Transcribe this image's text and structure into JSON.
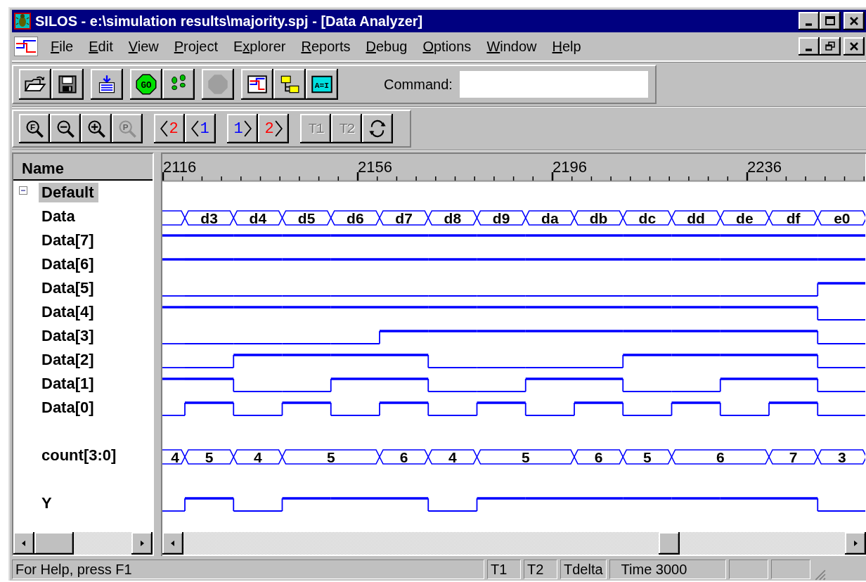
{
  "window": {
    "title": "SILOS - e:\\simulation results\\majority.spj - [Data Analyzer]"
  },
  "menu": [
    {
      "key": "F",
      "rest": "ile"
    },
    {
      "key": "E",
      "rest": "dit"
    },
    {
      "key": "V",
      "rest": "iew"
    },
    {
      "key": "P",
      "rest": "roject"
    },
    {
      "lead": "E",
      "key": "x",
      "rest": "plorer"
    },
    {
      "key": "R",
      "rest": "eports"
    },
    {
      "key": "D",
      "rest": "ebug"
    },
    {
      "key": "O",
      "rest": "ptions"
    },
    {
      "key": "W",
      "rest": "indow"
    },
    {
      "key": "H",
      "rest": "elp"
    }
  ],
  "toolbar": [
    [
      {
        "kind": "open",
        "disabled": false
      },
      {
        "kind": "save",
        "disabled": false
      }
    ],
    [
      {
        "kind": "load",
        "disabled": false
      }
    ],
    [
      {
        "kind": "go",
        "text": "GO",
        "disabled": false
      },
      {
        "kind": "step",
        "disabled": false
      }
    ],
    [
      {
        "kind": "stop",
        "disabled": true
      }
    ],
    [
      {
        "kind": "wave",
        "disabled": false
      },
      {
        "kind": "hierarchy",
        "disabled": false
      },
      {
        "kind": "assign",
        "text": "A=I",
        "disabled": false
      }
    ]
  ],
  "command": {
    "label": "Command:"
  },
  "zoombar": [
    [
      {
        "kind": "zoom-full",
        "letter": "F",
        "disabled": false
      },
      {
        "kind": "zoom-out",
        "disabled": false
      },
      {
        "kind": "zoom-in",
        "disabled": false
      },
      {
        "kind": "zoom-prev",
        "letter": "P",
        "disabled": true
      }
    ],
    [
      {
        "kind": "cursor-left",
        "label": "2",
        "color": "#ff0000",
        "disabled": false
      },
      {
        "kind": "cursor-left",
        "label": "1",
        "color": "#0000ff",
        "disabled": false
      }
    ],
    [
      {
        "kind": "cursor-right",
        "label": "1",
        "color": "#0000ff",
        "disabled": false
      },
      {
        "kind": "cursor-right",
        "label": "2",
        "color": "#ff0000",
        "disabled": false
      }
    ],
    [
      {
        "kind": "marker",
        "label": "T1",
        "disabled": true
      },
      {
        "kind": "marker",
        "label": "T2",
        "disabled": true
      },
      {
        "kind": "refresh",
        "disabled": false
      }
    ]
  ],
  "name_header": "Name",
  "ruler": {
    "labels": [
      "2116",
      "2156",
      "2196",
      "2236"
    ]
  },
  "group": {
    "name": "Default",
    "expanded": true,
    "selected": true,
    "children": [
      {
        "name": "Data",
        "kind": "bus",
        "separated": false,
        "segments": [
          {
            "value": "d3",
            "long": false
          },
          {
            "value": "d4",
            "long": false
          },
          {
            "value": "d5",
            "long": false
          },
          {
            "value": "d6",
            "long": false
          },
          {
            "value": "d7",
            "long": false
          },
          {
            "value": "d8",
            "long": false
          },
          {
            "value": "d9",
            "long": false
          },
          {
            "value": "da",
            "long": false
          },
          {
            "value": "db",
            "long": false
          },
          {
            "value": "dc",
            "long": false
          },
          {
            "value": "dd",
            "long": false
          },
          {
            "value": "de",
            "long": false
          },
          {
            "value": "df",
            "long": false
          },
          {
            "value": "e0",
            "long": false
          }
        ]
      },
      {
        "name": "Data[7]",
        "kind": "bit",
        "separated": false,
        "high": [
          true,
          true,
          true,
          true,
          true,
          true,
          true,
          true,
          true,
          true,
          true,
          true,
          true,
          true,
          true
        ]
      },
      {
        "name": "Data[6]",
        "kind": "bit",
        "separated": false,
        "high": [
          true,
          true,
          true,
          true,
          true,
          true,
          true,
          true,
          true,
          true,
          true,
          true,
          true,
          true,
          true
        ]
      },
      {
        "name": "Data[5]",
        "kind": "bit",
        "separated": false,
        "high": [
          false,
          false,
          false,
          false,
          false,
          false,
          false,
          false,
          false,
          false,
          false,
          false,
          false,
          false,
          true
        ]
      },
      {
        "name": "Data[4]",
        "kind": "bit",
        "separated": false,
        "high": [
          true,
          true,
          true,
          true,
          true,
          true,
          true,
          true,
          true,
          true,
          true,
          true,
          true,
          true,
          false
        ]
      },
      {
        "name": "Data[3]",
        "kind": "bit",
        "separated": false,
        "high": [
          false,
          false,
          false,
          false,
          false,
          true,
          true,
          true,
          true,
          true,
          true,
          true,
          true,
          true,
          false
        ]
      },
      {
        "name": "Data[2]",
        "kind": "bit",
        "separated": false,
        "high": [
          false,
          false,
          true,
          true,
          true,
          true,
          false,
          false,
          false,
          false,
          true,
          true,
          true,
          true,
          false
        ]
      },
      {
        "name": "Data[1]",
        "kind": "bit",
        "separated": false,
        "high": [
          true,
          true,
          false,
          false,
          true,
          true,
          false,
          false,
          true,
          true,
          false,
          false,
          true,
          true,
          false
        ]
      },
      {
        "name": "Data[0]",
        "kind": "bit",
        "separated": false,
        "high": [
          false,
          true,
          false,
          true,
          false,
          true,
          false,
          true,
          false,
          true,
          false,
          true,
          false,
          true,
          false
        ]
      },
      {
        "name": "count[3:0]",
        "kind": "bus",
        "separated": true,
        "lead": "4",
        "segments": [
          {
            "value": "5",
            "long": false
          },
          {
            "value": "4",
            "long": false
          },
          {
            "value": "5",
            "long": true
          },
          {
            "value": "6",
            "long": false
          },
          {
            "value": "4",
            "long": false
          },
          {
            "value": "5",
            "long": true
          },
          {
            "value": "6",
            "long": false
          },
          {
            "value": "5",
            "long": false
          },
          {
            "value": "6",
            "long": true
          },
          {
            "value": "7",
            "long": false
          },
          {
            "value": "3",
            "long": false
          }
        ]
      },
      {
        "name": "Y",
        "kind": "bit",
        "separated": true,
        "high": [
          false,
          true,
          false,
          true,
          true,
          true,
          false,
          true,
          true,
          true,
          true,
          true,
          true,
          true,
          false
        ]
      }
    ]
  },
  "status_bar": [
    "For Help, press F1",
    "T1",
    "T2",
    "Tdelta",
    "Time 3000"
  ]
}
